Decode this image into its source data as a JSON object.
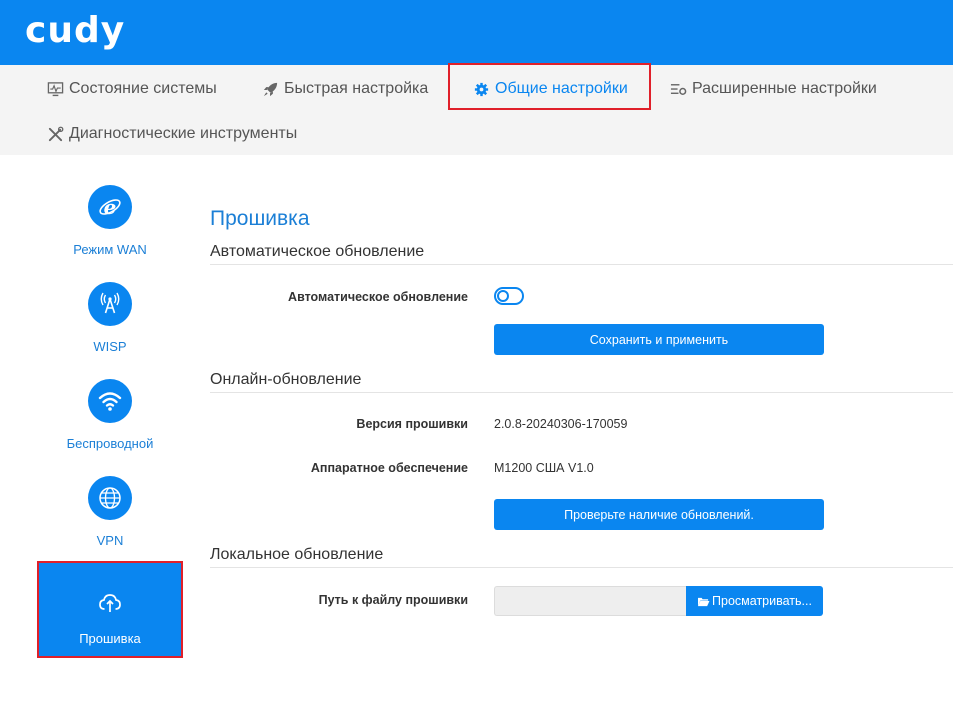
{
  "header": {
    "logo": "cudy"
  },
  "nav": {
    "items": [
      {
        "label": "Состояние системы",
        "icon": "monitor-icon"
      },
      {
        "label": "Быстрая настройка",
        "icon": "rocket-icon"
      },
      {
        "label": "Общие настройки",
        "icon": "gear-icon",
        "active": true
      },
      {
        "label": "Расширенные настройки",
        "icon": "settings-list-icon"
      },
      {
        "label": "Диагностические инструменты",
        "icon": "tools-icon"
      }
    ]
  },
  "sidebar": {
    "items": [
      {
        "label": "Режим WAN",
        "icon": "internet-explorer-icon"
      },
      {
        "label": "WISP",
        "icon": "wireless-tower-icon"
      },
      {
        "label": "Беспроводной",
        "icon": "wifi-icon"
      },
      {
        "label": "VPN",
        "icon": "globe-icon"
      },
      {
        "label": "Прошивка",
        "icon": "cloud-upload-icon",
        "active": true
      }
    ]
  },
  "main": {
    "title": "Прошивка",
    "auto_update": {
      "section_title": "Автоматическое обновление",
      "toggle_label": "Автоматическое обновление",
      "toggle_on": false,
      "save_button": "Сохранить и применить"
    },
    "online_update": {
      "section_title": "Онлайн-обновление",
      "firmware_label": "Версия прошивки",
      "firmware_value": "2.0.8-20240306-170059",
      "hardware_label": "Аппаратное обеспечение",
      "hardware_value": "M1200 США V1.0",
      "check_button": "Проверьте наличие обновлений."
    },
    "local_update": {
      "section_title": "Локальное обновление",
      "path_label": "Путь к файлу прошивки",
      "path_value": "",
      "browse_button": "Просматривать..."
    }
  },
  "colors": {
    "brand": "#0a86f0",
    "highlight": "#e0202a",
    "nav_bg": "#f4f4f4"
  }
}
